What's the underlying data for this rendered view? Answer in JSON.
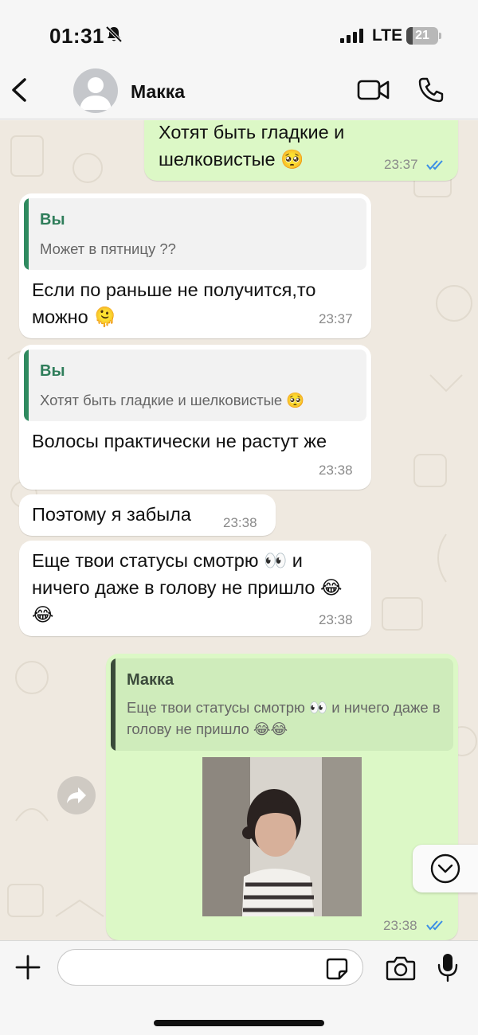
{
  "status_bar": {
    "time": "01:31",
    "network": "LTE",
    "battery_level": "21",
    "battery_fraction": 0.21
  },
  "header": {
    "contact_name": "Макка",
    "icons": [
      "back-chevron-icon",
      "avatar-placeholder",
      "video-call-icon",
      "phone-call-icon"
    ]
  },
  "messages": [
    {
      "direction": "outgoing",
      "text": "Хотят быть гладкие и шелковистые 🥺",
      "time": "23:37",
      "read": true
    },
    {
      "direction": "incoming",
      "reply_to": {
        "name": "Вы",
        "text": "Может в пятницу ??"
      },
      "text": "Если по раньше не получится,то можно 🫠",
      "time": "23:37"
    },
    {
      "direction": "incoming",
      "reply_to": {
        "name": "Вы",
        "text": "Хотят быть гладкие и шелковистые 🥺"
      },
      "text": "Волосы практически не растут же",
      "time": "23:38"
    },
    {
      "direction": "incoming",
      "text": "Поэтому я забыла",
      "time": "23:38"
    },
    {
      "direction": "incoming",
      "text": "Еще твои статусы смотрю 👀 и ничего даже в голову не пришло 😂😂",
      "time": "23:38"
    },
    {
      "direction": "outgoing",
      "reply_to": {
        "name": "Макка",
        "text": "Еще твои статусы смотрю 👀 и ничего даже в голову не пришло 😂😂"
      },
      "attachment": "photo",
      "time": "23:38",
      "read": true
    }
  ],
  "composer": {
    "placeholder": "",
    "icons": [
      "plus-icon",
      "sticker-icon",
      "camera-icon",
      "microphone-icon"
    ]
  },
  "colors": {
    "incoming_bubble": "#ffffff",
    "outgoing_bubble": "#dcf8c6",
    "chat_background": "#efe9e0",
    "quote_accent": "#2f8a5f",
    "read_ticks": "#3a8ee6"
  }
}
